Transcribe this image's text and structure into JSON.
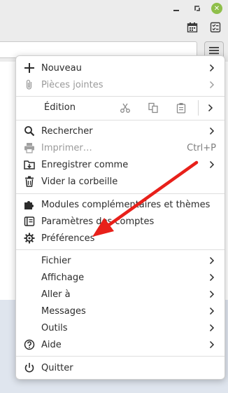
{
  "window": {
    "close_glyph": "✕"
  },
  "menu": {
    "group1": [
      {
        "label": "Nouveau",
        "icon": "plus-icon",
        "submenu": true,
        "disabled": false
      },
      {
        "label": "Pièces jointes",
        "icon": "paperclip-icon",
        "submenu": true,
        "disabled": true
      }
    ],
    "edit": {
      "label": "Édition"
    },
    "group2": [
      {
        "label": "Rechercher",
        "icon": "search-icon",
        "submenu": true
      },
      {
        "label": "Imprimer…",
        "icon": "printer-icon",
        "shortcut": "Ctrl+P",
        "disabled": true
      },
      {
        "label": "Enregistrer comme",
        "icon": "save-folder-icon",
        "submenu": true
      },
      {
        "label": "Vider la corbeille",
        "icon": "trash-icon"
      }
    ],
    "group3": [
      {
        "label": "Modules complémentaires et thèmes",
        "icon": "puzzle-icon"
      },
      {
        "label": "Paramètres des comptes",
        "icon": "account-icon"
      },
      {
        "label": "Préférences",
        "icon": "gear-icon"
      }
    ],
    "group4": [
      {
        "label": "Fichier",
        "submenu": true
      },
      {
        "label": "Affichage",
        "submenu": true
      },
      {
        "label": "Aller à",
        "submenu": true
      },
      {
        "label": "Messages",
        "submenu": true
      },
      {
        "label": "Outils",
        "submenu": true
      },
      {
        "label": "Aide",
        "icon": "help-icon",
        "submenu": true
      }
    ],
    "quit": {
      "label": "Quitter",
      "icon": "power-icon"
    }
  },
  "colors": {
    "annotation_arrow": "#e8201a",
    "close_button": "#8fbf4a"
  }
}
